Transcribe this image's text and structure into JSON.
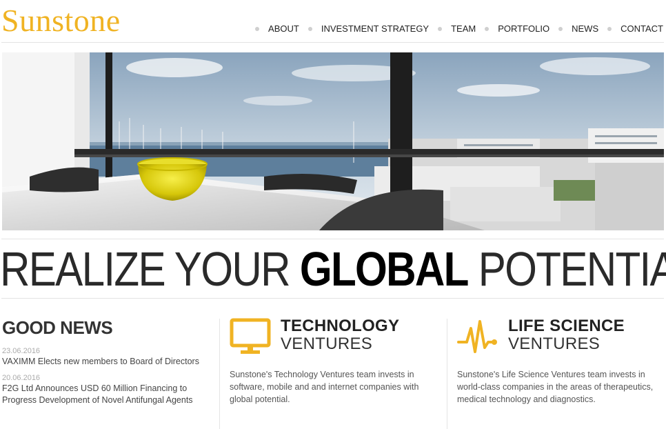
{
  "brand": {
    "logo_text": "Sunstone",
    "accent": "#f0b323"
  },
  "nav": {
    "items": [
      {
        "label": "ABOUT"
      },
      {
        "label": "INVESTMENT STRATEGY"
      },
      {
        "label": "TEAM"
      },
      {
        "label": "PORTFOLIO"
      },
      {
        "label": "NEWS"
      },
      {
        "label": "CONTACT"
      }
    ]
  },
  "hero": {
    "image": "office-view-harbor-photo"
  },
  "tagline": {
    "part1": "REALIZE YOUR ",
    "part2": "GLOBAL",
    "part3": " POTENTIAL"
  },
  "news": {
    "title": "GOOD NEWS",
    "items": [
      {
        "date": "23.06.2016",
        "text": "VAXIMM Elects new members to Board of Directors"
      },
      {
        "date": "20.06.2016",
        "text": "F2G Ltd Announces USD 60 Million Financing to Progress Development of Novel Antifungal Agents"
      }
    ]
  },
  "technology": {
    "title_bold": "TECHNOLOGY",
    "title_light": "VENTURES",
    "icon": "monitor-icon",
    "text": "Sunstone's Technology Ventures team invests in software, mobile and and internet companies with global potential."
  },
  "lifescience": {
    "title_bold": "LIFE SCIENCE",
    "title_light": "VENTURES",
    "icon": "heartbeat-icon",
    "text": "Sunstone's Life Science Ventures team invests in world-class companies in the areas of therapeutics, medical technology and diagnostics."
  }
}
